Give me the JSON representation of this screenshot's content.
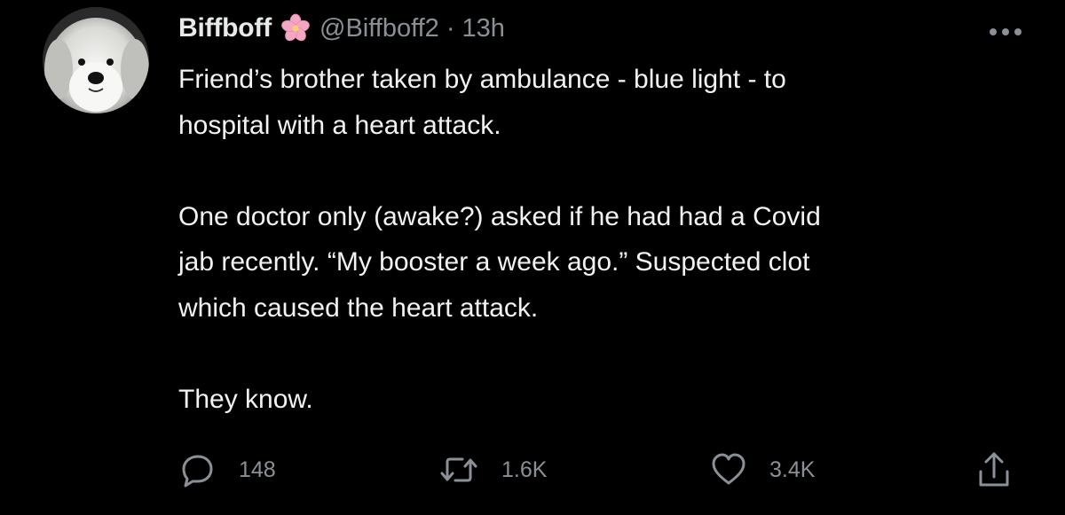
{
  "tweet": {
    "display_name": "Biffboff",
    "handle": "@Biffboff2",
    "separator": "·",
    "time": "13h",
    "paragraphs": [
      [
        "Friend’s brother taken by ambulance - blue light - to",
        "hospital with a heart attack."
      ],
      [
        "One doctor only (awake?) asked if he had had a Covid",
        "jab  recently. “My booster a week ago.” Suspected clot",
        "which caused the heart attack."
      ],
      [
        "They know."
      ]
    ]
  },
  "actions": {
    "reply_count": "148",
    "retweet_count": "1.6K",
    "like_count": "3.4K"
  },
  "icons": {
    "avatar": "dog-avatar",
    "badge": "cherry-blossom-icon",
    "more": "more-icon",
    "reply": "reply-icon",
    "retweet": "retweet-icon",
    "like": "heart-icon",
    "share": "share-icon"
  },
  "colors": {
    "background": "#000000",
    "primary_text": "#e7e9ea",
    "secondary_text": "#8b9096",
    "flower_pink": "#f4a7c3"
  }
}
